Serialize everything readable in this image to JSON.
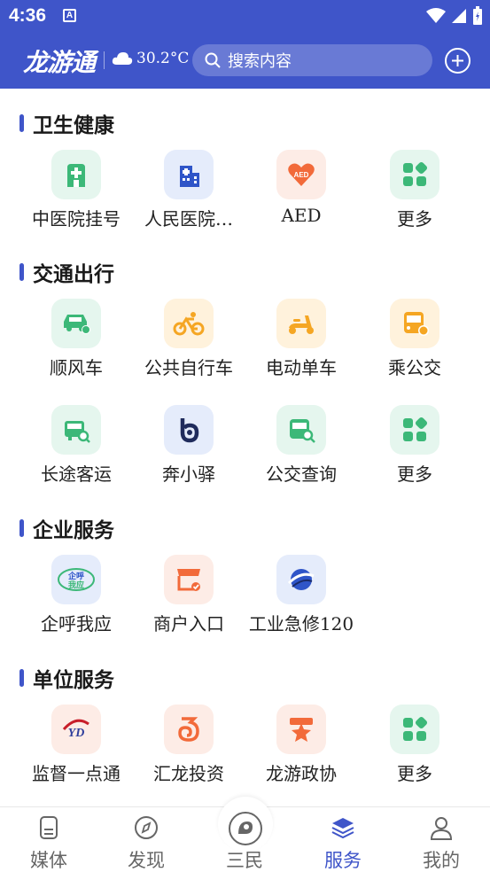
{
  "status_bar": {
    "time": "4:36",
    "notif_letter": "A"
  },
  "header": {
    "logo": "龙游通",
    "weather": "30.2°C",
    "search_placeholder": "搜索内容"
  },
  "sections": [
    {
      "title": "卫生健康",
      "items": [
        {
          "label": "中医院挂号",
          "icon": "hospital-cross-icon"
        },
        {
          "label": "人民医院…",
          "icon": "hospital-building-icon"
        },
        {
          "label": "AED",
          "icon": "aed-heart-icon"
        },
        {
          "label": "更多",
          "icon": "more-grid-icon"
        }
      ]
    },
    {
      "title": "交通出行",
      "items": [
        {
          "label": "顺风车",
          "icon": "car-icon"
        },
        {
          "label": "公共自行车",
          "icon": "bicycle-icon"
        },
        {
          "label": "电动单车",
          "icon": "scooter-icon"
        },
        {
          "label": "乘公交",
          "icon": "bus-icon"
        },
        {
          "label": "长途客运",
          "icon": "coach-search-icon"
        },
        {
          "label": "奔小驿",
          "icon": "benxiaoyi-icon"
        },
        {
          "label": "公交查询",
          "icon": "bus-search-icon"
        },
        {
          "label": "更多",
          "icon": "more-grid-icon"
        }
      ]
    },
    {
      "title": "企业服务",
      "items": [
        {
          "label": "企呼我应",
          "icon": "qihu-woying-icon"
        },
        {
          "label": "商户入口",
          "icon": "shop-icon"
        },
        {
          "label": "工业急修120",
          "icon": "repair-globe-icon"
        }
      ]
    },
    {
      "title": "单位服务",
      "items": [
        {
          "label": "监督一点通",
          "icon": "supervision-icon"
        },
        {
          "label": "汇龙投资",
          "icon": "dragon-icon"
        },
        {
          "label": "龙游政协",
          "icon": "cppcc-star-icon"
        },
        {
          "label": "更多",
          "icon": "more-grid-icon"
        }
      ]
    }
  ],
  "bottom_nav": [
    {
      "label": "媒体",
      "icon": "document-icon"
    },
    {
      "label": "发现",
      "icon": "compass-icon"
    },
    {
      "label": "三民",
      "icon": "sanmin-icon"
    },
    {
      "label": "服务",
      "icon": "layers-icon",
      "active": true
    },
    {
      "label": "我的",
      "icon": "user-icon"
    }
  ],
  "colors": {
    "primary": "#3f55c9",
    "green": "#3cb878",
    "orange": "#f26a3a",
    "amber": "#f5a623",
    "blue": "#2f55c8"
  }
}
